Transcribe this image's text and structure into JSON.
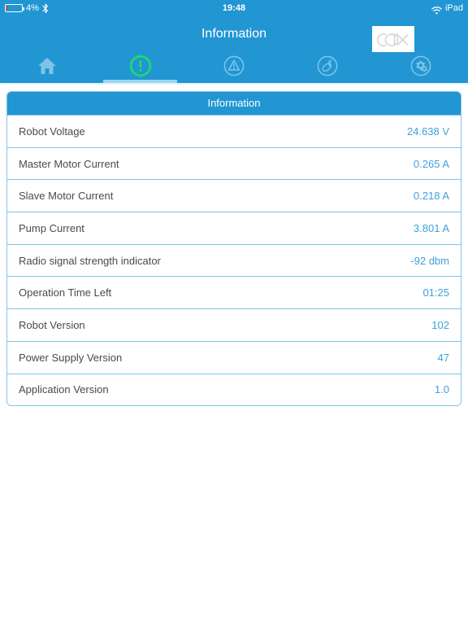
{
  "status_bar": {
    "battery_percent": "4%",
    "battery_icon": "battery-low-icon",
    "bluetooth_icon": "bluetooth-icon",
    "time": "19:48",
    "wifi_icon": "wifi-icon",
    "device_label": "iPad"
  },
  "nav_bar": {
    "title": "Information",
    "brand_logo_text": "CTX"
  },
  "tabs": [
    {
      "name": "home",
      "icon": "home-icon",
      "label": "",
      "active": false
    },
    {
      "name": "information",
      "icon": "exclamation-circle-icon",
      "label": "",
      "active": true
    },
    {
      "name": "alarms",
      "icon": "warning-triangle-circle-icon",
      "label": "",
      "active": false
    },
    {
      "name": "remote",
      "icon": "remote-signal-icon",
      "label": "",
      "active": false
    },
    {
      "name": "settings",
      "icon": "gears-circle-icon",
      "label": "",
      "active": false
    }
  ],
  "card": {
    "header": "Information",
    "rows": [
      {
        "label": "Robot Voltage",
        "value": "24.638 V"
      },
      {
        "label": "Master Motor Current",
        "value": "0.265 A"
      },
      {
        "label": "Slave Motor Current",
        "value": "0.218 A"
      },
      {
        "label": "Pump Current",
        "value": "3.801 A"
      },
      {
        "label": "Radio signal strength indicator",
        "value": "-92 dbm"
      },
      {
        "label": "Operation Time Left",
        "value": "01:25"
      },
      {
        "label": "Robot Version",
        "value": "102"
      },
      {
        "label": "Power Supply Version",
        "value": "47"
      },
      {
        "label": "Application Version",
        "value": "1.0"
      }
    ]
  },
  "colors": {
    "brand_blue": "#2196d3",
    "value_blue": "#3fa0dd",
    "separator_blue": "#7ec5e9",
    "active_green": "#27e06a",
    "label_gray": "#4a4a4a",
    "battery_red": "#e8453c"
  }
}
